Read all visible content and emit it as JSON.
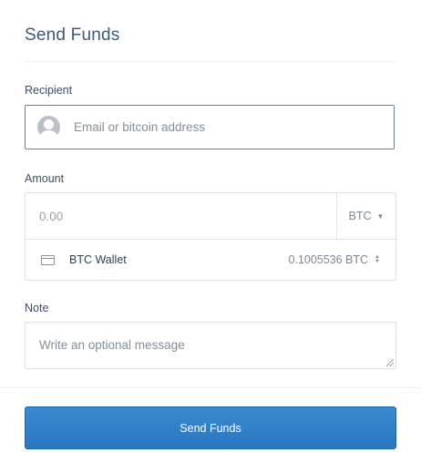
{
  "header": {
    "title": "Send Funds"
  },
  "recipient": {
    "label": "Recipient",
    "placeholder": "Email or bitcoin address",
    "avatar_icon": "user-avatar-icon"
  },
  "amount": {
    "label": "Amount",
    "placeholder": "0.00",
    "currency": "BTC",
    "currency_caret": "▼",
    "wallet": {
      "icon": "wallet-icon",
      "name": "BTC Wallet",
      "balance": "0.1005536 BTC"
    }
  },
  "note": {
    "label": "Note",
    "placeholder": "Write an optional message"
  },
  "actions": {
    "send_label": "Send Funds"
  },
  "colors": {
    "primary_button": "#2f7dc6",
    "title": "#3d5a7a"
  }
}
